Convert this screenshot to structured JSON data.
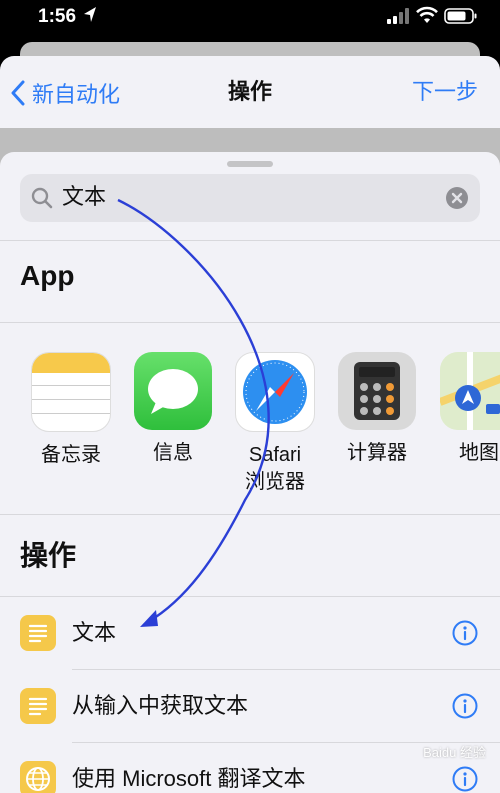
{
  "status_bar": {
    "time": "1:56"
  },
  "nav": {
    "back_label": "新自动化",
    "title": "操作",
    "next_label": "下一步"
  },
  "search": {
    "value": "文本"
  },
  "apps_section": {
    "title": "App",
    "apps": [
      {
        "label": "备忘录",
        "label2": ""
      },
      {
        "label": "信息",
        "label2": ""
      },
      {
        "label": "Safari",
        "label2": "浏览器"
      },
      {
        "label": "计算器",
        "label2": ""
      },
      {
        "label": "地图",
        "label2": ""
      }
    ]
  },
  "actions_section": {
    "title": "操作",
    "items": [
      {
        "label": "文本",
        "icon": "text-doc-icon"
      },
      {
        "label": "从输入中获取文本",
        "icon": "text-doc-icon"
      },
      {
        "label": "使用 Microsoft 翻译文本",
        "icon": "globe-icon"
      }
    ]
  },
  "watermark": {
    "text": "Baidu 经验"
  },
  "colors": {
    "accent": "#2f7cf6",
    "action_icon": "#f5c84a",
    "annotation_arrow": "#2b3fd6"
  }
}
